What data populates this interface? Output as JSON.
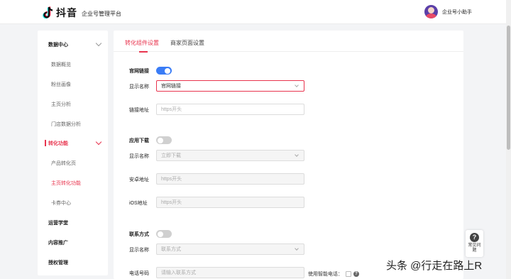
{
  "header": {
    "brand": "抖音",
    "platform": "企业号管理平台",
    "user_name": "企业号小助手"
  },
  "sidebar": {
    "items": [
      {
        "label": "数据中心",
        "kind": "group"
      },
      {
        "label": "数据概览",
        "kind": "sub"
      },
      {
        "label": "粉丝画像",
        "kind": "sub"
      },
      {
        "label": "主页分析",
        "kind": "sub"
      },
      {
        "label": "门店数据分析",
        "kind": "sub"
      },
      {
        "label": "转化功能",
        "kind": "group-active"
      },
      {
        "label": "产品转化页",
        "kind": "sub"
      },
      {
        "label": "主页转化功能",
        "kind": "sub-active"
      },
      {
        "label": "卡券中心",
        "kind": "sub"
      },
      {
        "label": "运营学堂",
        "kind": "group"
      },
      {
        "label": "内容推广",
        "kind": "group"
      },
      {
        "label": "授权管理",
        "kind": "group"
      }
    ]
  },
  "tabs": [
    {
      "label": "转化组件设置",
      "active": true
    },
    {
      "label": "商家页面设置",
      "active": false
    }
  ],
  "form": {
    "website": {
      "section_label": "官网链接",
      "enabled": true,
      "display_name_label": "显示名称",
      "display_name_value": "官网链接",
      "link_label": "链接地址",
      "link_placeholder": "https开头"
    },
    "app_download": {
      "section_label": "应用下载",
      "enabled": false,
      "display_name_label": "显示名称",
      "display_name_value": "立即下载",
      "android_label": "安卓地址",
      "android_placeholder": "https开头",
      "ios_label": "iOS地址",
      "ios_placeholder": "https开头"
    },
    "contact": {
      "section_label": "联系方式",
      "enabled": false,
      "display_name_label": "显示名称",
      "display_name_value": "联系方式",
      "phone_label": "电话号码",
      "phone_placeholder": "请输入联系方式",
      "smart_phone_label": "使用智能电话："
    }
  },
  "faq": {
    "icon": "?",
    "label": "常见问题"
  },
  "watermark": "头条 @行走在路上R",
  "colors": {
    "accent": "#e8344e",
    "toggle_on": "#3a7cf6",
    "toggle_off": "#d0d0d0"
  }
}
